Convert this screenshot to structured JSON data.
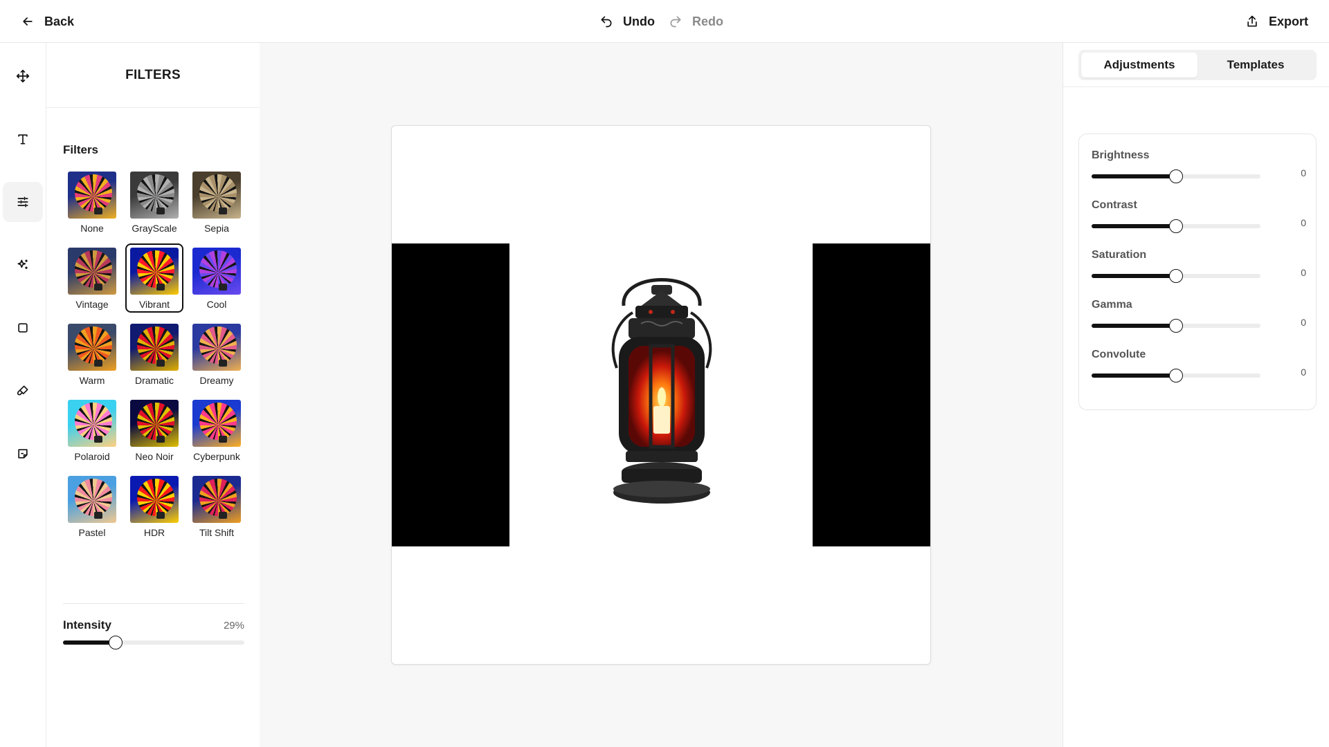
{
  "topbar": {
    "back_label": "Back",
    "undo_label": "Undo",
    "redo_label": "Redo",
    "export_label": "Export"
  },
  "rail": {
    "tools": [
      {
        "icon": "move-icon"
      },
      {
        "icon": "text-icon"
      },
      {
        "icon": "adjust-sliders-icon",
        "active": true
      },
      {
        "icon": "sparkle-icon"
      },
      {
        "icon": "square-shape-icon"
      },
      {
        "icon": "brush-icon"
      },
      {
        "icon": "sticker-icon"
      }
    ]
  },
  "filters_panel": {
    "title": "FILTERS",
    "section_label": "Filters",
    "selected": "Vibrant",
    "items": [
      {
        "label": "None",
        "colors": [
          "#e43d78",
          "#1e2f8a",
          "#f0b020"
        ]
      },
      {
        "label": "GrayScale",
        "colors": [
          "#8a8a8a",
          "#3a3a3a",
          "#b0b0b0"
        ]
      },
      {
        "label": "Sepia",
        "colors": [
          "#a8906a",
          "#4a3e2c",
          "#c8b48c"
        ]
      },
      {
        "label": "Vintage",
        "colors": [
          "#b8385a",
          "#2a3a6a",
          "#d09a40"
        ]
      },
      {
        "label": "Vibrant",
        "colors": [
          "#ff1a2a",
          "#0a1aa0",
          "#ffcc00"
        ]
      },
      {
        "label": "Cool",
        "colors": [
          "#b040e0",
          "#1a2ad0",
          "#6a4af0"
        ]
      },
      {
        "label": "Warm",
        "colors": [
          "#f05a20",
          "#3a4a6a",
          "#f0a020"
        ]
      },
      {
        "label": "Dramatic",
        "colors": [
          "#e0102a",
          "#101a70",
          "#e0b000"
        ]
      },
      {
        "label": "Dreamy",
        "colors": [
          "#e05a8a",
          "#2a3aa0",
          "#f0b050"
        ]
      },
      {
        "label": "Polaroid",
        "colors": [
          "#ff7ad0",
          "#3ad0f0",
          "#ffd080"
        ]
      },
      {
        "label": "Neo Noir",
        "colors": [
          "#e0102a",
          "#0a0a40",
          "#e0c000"
        ]
      },
      {
        "label": "Cyberpunk",
        "colors": [
          "#ff3a8a",
          "#1a3ad0",
          "#ffb020"
        ]
      },
      {
        "label": "Pastel",
        "colors": [
          "#f08aa0",
          "#4aa0e0",
          "#f0c890"
        ]
      },
      {
        "label": "HDR",
        "colors": [
          "#ff1a1a",
          "#0a1ab0",
          "#ffd000"
        ]
      },
      {
        "label": "Tilt Shift",
        "colors": [
          "#e0205a",
          "#1a2a90",
          "#f0a020"
        ]
      }
    ],
    "intensity_label": "Intensity",
    "intensity_value": "29%",
    "intensity_level": 29
  },
  "right_panel": {
    "tabs": [
      {
        "label": "Adjustments",
        "active": true
      },
      {
        "label": "Templates",
        "active": false
      }
    ],
    "adjustments": [
      {
        "label": "Brightness",
        "value": "0",
        "level": 0.5
      },
      {
        "label": "Contrast",
        "value": "0",
        "level": 0.5
      },
      {
        "label": "Saturation",
        "value": "0",
        "level": 0.5
      },
      {
        "label": "Gamma",
        "value": "0",
        "level": 0.5
      },
      {
        "label": "Convolute",
        "value": "0",
        "level": 0.5
      }
    ]
  }
}
